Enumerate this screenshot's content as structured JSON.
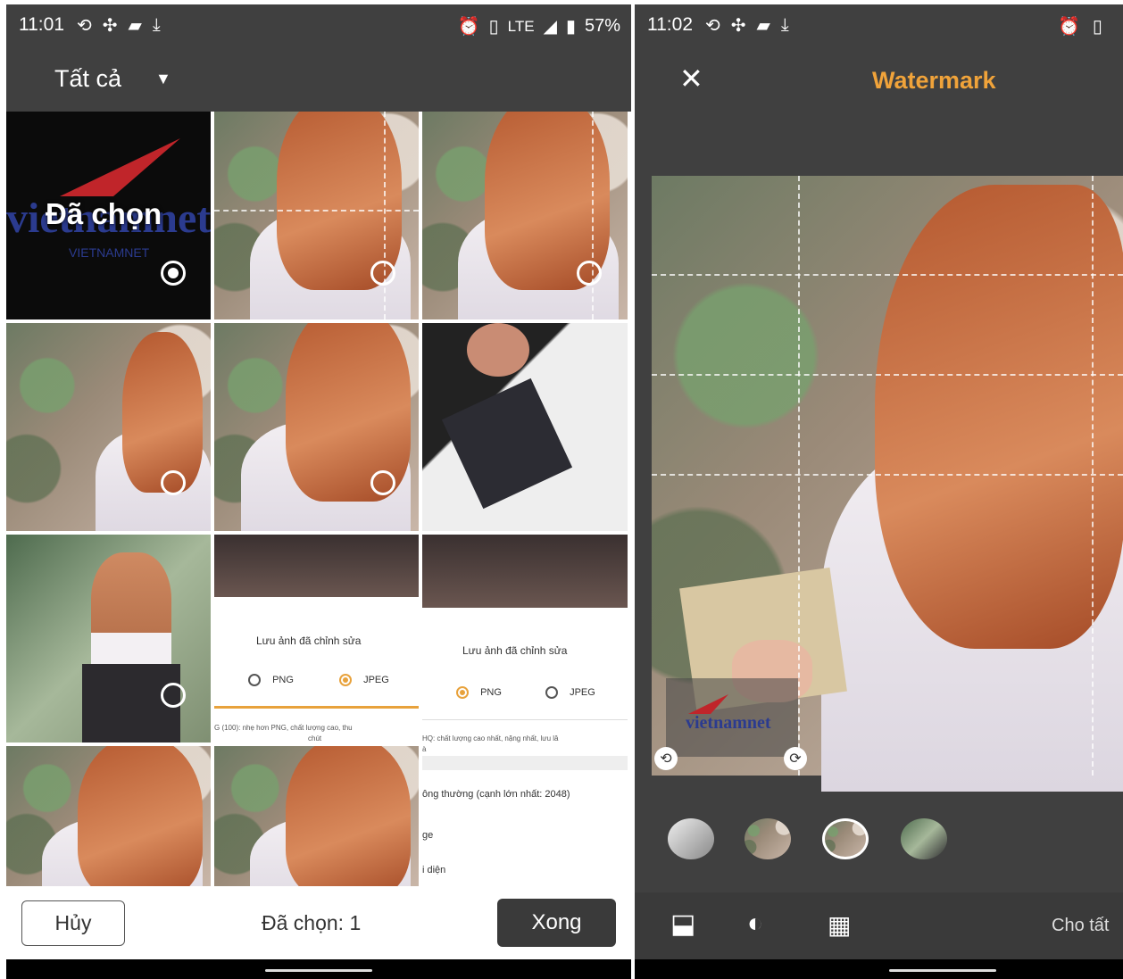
{
  "left_phone": {
    "status": {
      "time": "11:01",
      "network": "LTE",
      "battery": "57%"
    },
    "header": {
      "title": "Tất cả"
    },
    "gallery": {
      "selected_overlay": "Đã chọn"
    },
    "dialog1": {
      "title": "Lưu ảnh đã chỉnh sửa",
      "option_png": "PNG",
      "option_jpeg": "JPEG",
      "note": "G (100): nhẹ hơn PNG, chất lượng cao, thu",
      "note2": "chút"
    },
    "dialog2": {
      "title": "Lưu ảnh đã chỉnh sửa",
      "option_png": "PNG",
      "option_jpeg": "JPEG",
      "note": "HQ: chất lượng cao nhất, nặng nhất, lưu lâ",
      "note2": "à",
      "item1": "ông thường (cạnh lớn nhất: 2048)",
      "item2": "ge",
      "item3": "i diện"
    },
    "footer": {
      "cancel": "Hủy",
      "selected_count": "Đã chọn: 1",
      "done": "Xong"
    }
  },
  "right_phone": {
    "status": {
      "time": "11:02"
    },
    "header": {
      "title": "Watermark"
    },
    "watermark_logo": "vietnamnet",
    "toolbar": {
      "apply_all": "Cho tất"
    }
  },
  "logo_text": {
    "big": "vietnamnet",
    "small": "VIETNAMNET"
  },
  "colors": {
    "accent": "#f0a33a",
    "dark_bar": "#3a3a3a",
    "panel_bg": "#404040"
  }
}
